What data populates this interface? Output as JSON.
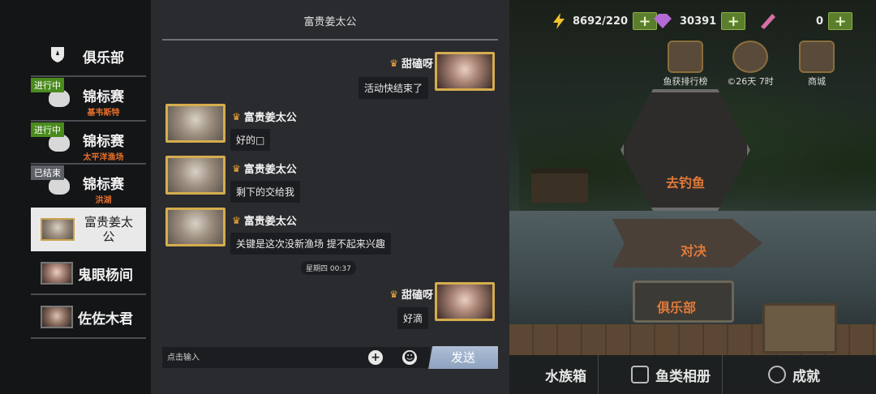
{
  "game": {
    "energy": "8692/220",
    "gems": "30391",
    "tickets": "0",
    "shop": [
      {
        "label": "鱼获排行榜"
      },
      {
        "label": "©26天 7时"
      },
      {
        "label": "商城"
      }
    ],
    "sign_fish": "去钓鱼",
    "sign_duel": "对决",
    "sign_club": "俱乐部",
    "bottom_nav": [
      {
        "label": "水族箱"
      },
      {
        "label": "鱼类相册"
      },
      {
        "label": "成就"
      }
    ]
  },
  "sidebar": {
    "club": "俱乐部",
    "events": [
      {
        "tag": "进行中",
        "label": "锦标赛",
        "sub": "基韦斯特"
      },
      {
        "tag": "进行中",
        "label": "锦标赛",
        "sub": "太平洋渔场"
      },
      {
        "tag": "已结束",
        "label": "锦标赛",
        "sub": "洪湖"
      }
    ],
    "contacts": [
      {
        "name": "富贵姜太公"
      },
      {
        "name": "鬼眼杨间"
      },
      {
        "name": "佐佐木君"
      }
    ]
  },
  "chat": {
    "title": "富贵姜太公",
    "messages": [
      {
        "sender": "甜磕呀",
        "text": "活动快结束了"
      },
      {
        "sender": "富贵姜太公",
        "text": "好的□"
      },
      {
        "sender": "富贵姜太公",
        "text": "剩下的交给我"
      },
      {
        "sender": "富贵姜太公",
        "text": "关键是这次没新渔场 提不起来兴趣"
      },
      {
        "sender": "甜磕呀",
        "text": "好滴"
      }
    ],
    "timestamp": "星期四 00:37",
    "input_placeholder": "点击输入",
    "send_label": "发送",
    "plus_glyph": "+",
    "emoji_glyph": "☻",
    "crown_glyph": "♛"
  }
}
